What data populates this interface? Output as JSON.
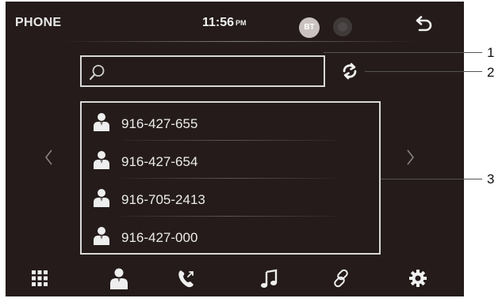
{
  "header": {
    "title": "PHONE",
    "time": "11:56",
    "ampm": "PM",
    "bt_label": "BT"
  },
  "contacts": [
    {
      "number": "916-427-655"
    },
    {
      "number": "916-427-654"
    },
    {
      "number": "916-705-2413"
    },
    {
      "number": "916-427-000"
    }
  ],
  "bottom_tabs": [
    {
      "icon": "keypad-grid-icon"
    },
    {
      "icon": "contacts-person-icon"
    },
    {
      "icon": "call-log-phone-icon"
    },
    {
      "icon": "music-note-icon"
    },
    {
      "icon": "link-chain-icon"
    },
    {
      "icon": "settings-gear-icon"
    }
  ],
  "callouts": [
    "1",
    "2",
    "3"
  ],
  "colors": {
    "screen_bg": "#241b1a",
    "text": "#ececec",
    "border": "#d8d8d8"
  }
}
